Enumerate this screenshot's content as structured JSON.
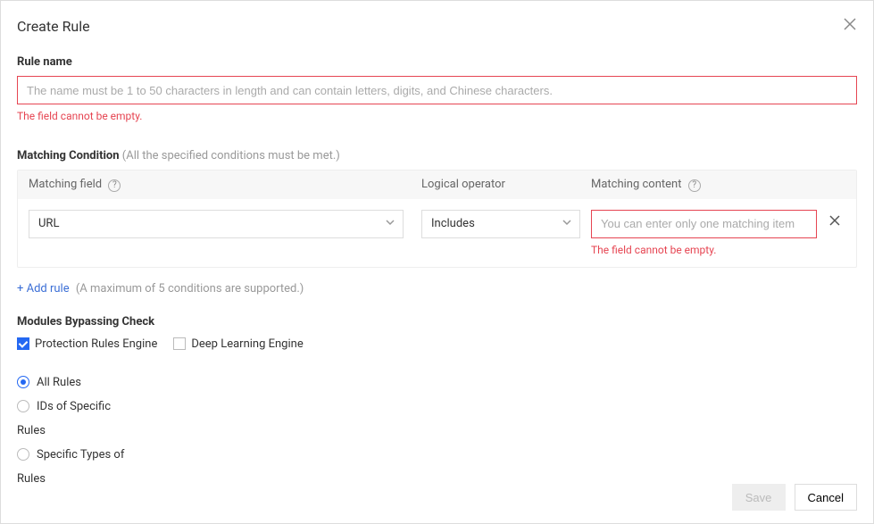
{
  "dialog": {
    "title": "Create Rule"
  },
  "ruleName": {
    "label": "Rule name",
    "placeholder": "The name must be 1 to 50 characters in length and can contain letters, digits, and Chinese characters.",
    "error": "The field cannot be empty."
  },
  "matching": {
    "title": "Matching Condition",
    "hint": "(All the specified conditions must be met.)",
    "headers": {
      "field": "Matching field",
      "operator": "Logical operator",
      "content": "Matching content"
    },
    "row": {
      "fieldValue": "URL",
      "operatorValue": "Includes",
      "contentPlaceholder": "You can enter only one matching item",
      "contentError": "The field cannot be empty."
    },
    "addRule": "+ Add rule",
    "addRuleHint": "(A maximum of 5 conditions are supported.)"
  },
  "modules": {
    "title": "Modules Bypassing Check",
    "checkboxes": [
      {
        "label": "Protection Rules Engine",
        "checked": true
      },
      {
        "label": "Deep Learning Engine",
        "checked": false
      }
    ],
    "radios": [
      {
        "label": "All Rules",
        "selected": true,
        "cont": ""
      },
      {
        "label": "IDs of Specific",
        "selected": false,
        "cont": "Rules"
      },
      {
        "label": "Specific Types of",
        "selected": false,
        "cont": "Rules"
      }
    ]
  },
  "footer": {
    "save": "Save",
    "cancel": "Cancel"
  }
}
